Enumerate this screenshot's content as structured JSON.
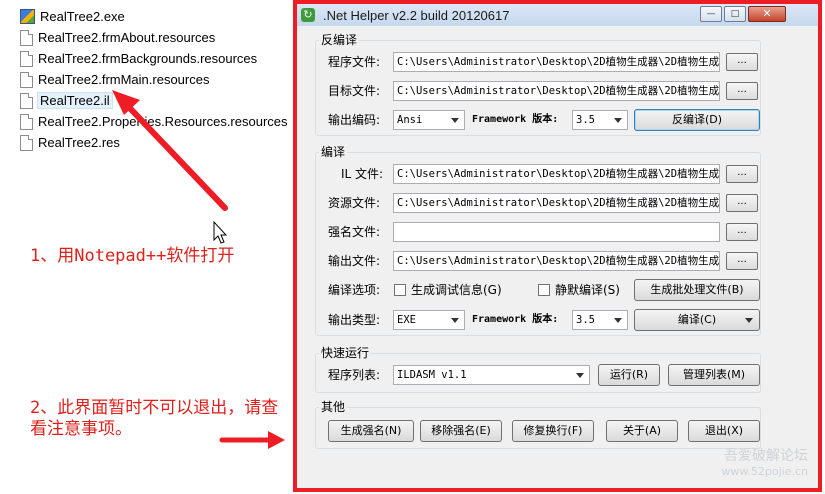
{
  "files": [
    {
      "name": "RealTree2.exe",
      "icon": "exe-icon"
    },
    {
      "name": "RealTree2.frmAbout.resources",
      "icon": "file-icon"
    },
    {
      "name": "RealTree2.frmBackgrounds.resources",
      "icon": "file-icon"
    },
    {
      "name": "RealTree2.frmMain.resources",
      "icon": "file-icon"
    },
    {
      "name": "RealTree2.il",
      "icon": "file-icon",
      "selected": true
    },
    {
      "name": "RealTree2.Properties.Resources.resources",
      "icon": "file-icon"
    },
    {
      "name": "RealTree2.res",
      "icon": "file-icon"
    }
  ],
  "annotations": {
    "note1": "1、用Notepad++软件打开",
    "note2": "2、此界面暂时不可以退出，请查看注意事项。",
    "color": "#e0201b"
  },
  "window": {
    "title": ".Net Helper v2.2 build 20120617",
    "border_color": "#ee1c25",
    "decompile": {
      "group_title": "反编译",
      "program_label": "程序文件:",
      "program_value": "C:\\Users\\Administrator\\Desktop\\2D植物生成器\\2D植物生成",
      "target_label": "目标文件:",
      "target_value": "C:\\Users\\Administrator\\Desktop\\2D植物生成器\\2D植物生成",
      "encoding_label": "输出编码:",
      "encoding_value": "Ansi",
      "framework_label": "Framework 版本:",
      "framework_value": "3.5",
      "decompile_button": "反编译(D)",
      "browse": "..."
    },
    "compile": {
      "group_title": "编译",
      "il_label": "IL 文件:",
      "il_value": "C:\\Users\\Administrator\\Desktop\\2D植物生成器\\2D植物生成",
      "res_label": "资源文件:",
      "res_value": "C:\\Users\\Administrator\\Desktop\\2D植物生成器\\2D植物生成",
      "strongname_label": "强名文件:",
      "strongname_value": "",
      "output_label": "输出文件:",
      "output_value": "C:\\Users\\Administrator\\Desktop\\2D植物生成器\\2D植物生成",
      "options_label": "编译选项:",
      "debug_check": "生成调试信息(G)",
      "silent_check": "静默编译(S)",
      "batch_button": "生成批处理文件(B)",
      "type_label": "输出类型:",
      "type_value": "EXE",
      "framework_label": "Framework 版本:",
      "framework_value": "3.5",
      "compile_button": "编译(C)",
      "browse": "..."
    },
    "quickrun": {
      "group_title": "快速运行",
      "list_label": "程序列表:",
      "list_value": "ILDASM v1.1",
      "run_button": "运行(R)",
      "manage_button": "管理列表(M)"
    },
    "other": {
      "group_title": "其他",
      "gen_sn_button": "生成强名(N)",
      "remove_sn_button": "移除强名(E)",
      "fix_newline_button": "修复换行(F)",
      "about_button": "关于(A)",
      "exit_button": "退出(X)"
    }
  },
  "watermark": {
    "line1": "吾爱破解论坛",
    "line2": "www.52pojie.cn"
  }
}
